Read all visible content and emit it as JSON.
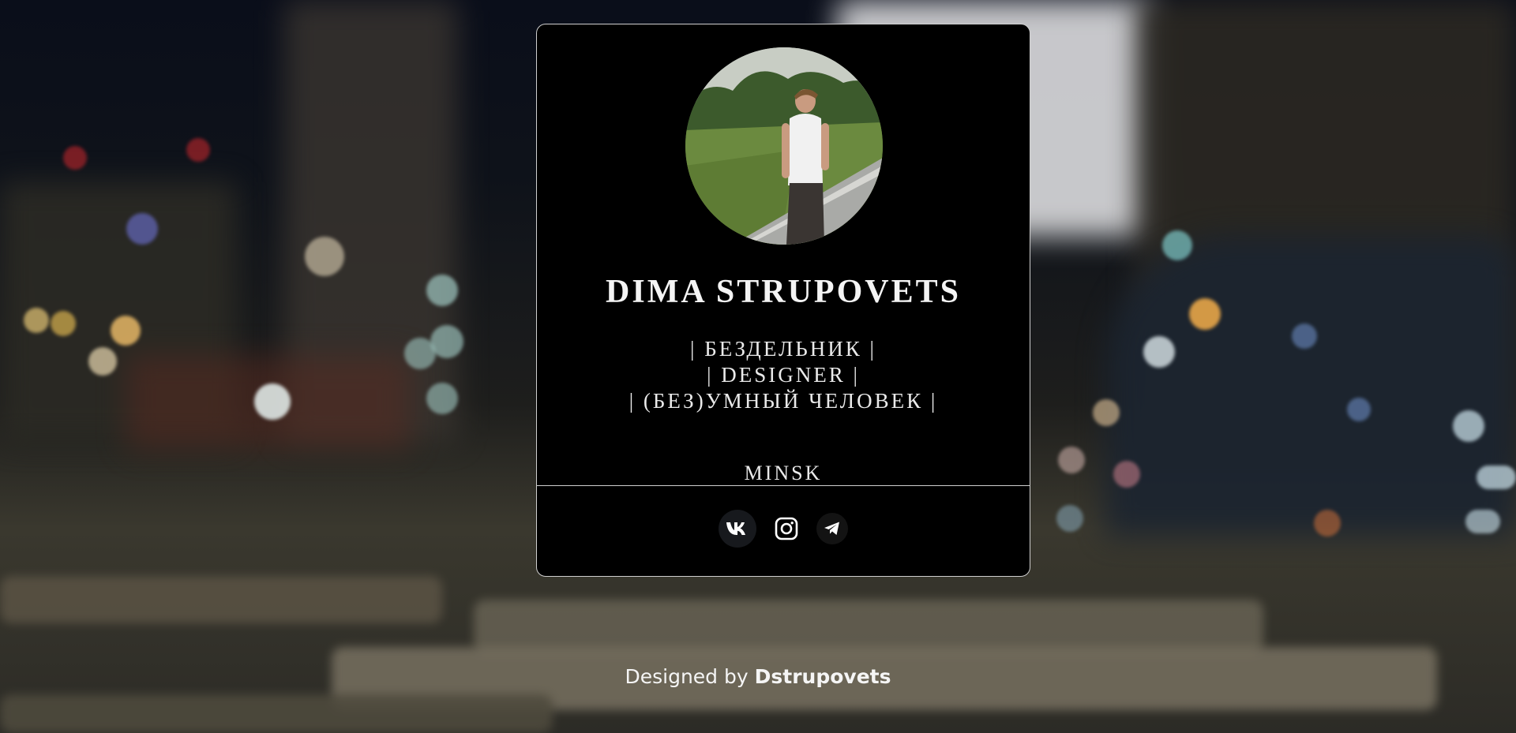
{
  "profile": {
    "name": "DIMA STRUPOVETS",
    "roles": [
      "| БЕЗДЕЛЬНИК |",
      "| DESIGNER |",
      "| (БЕЗ)УМНЫЙ ЧЕЛОВЕК |"
    ],
    "city": "MINSK"
  },
  "socials": [
    {
      "icon": "vk-icon"
    },
    {
      "icon": "instagram-icon"
    },
    {
      "icon": "telegram-icon"
    }
  ],
  "footer": {
    "prefix": "Designed by",
    "author": "Dstrupovets"
  },
  "colors": {
    "card_bg": "#000000",
    "card_border": "#cfcfcf",
    "text": "#eaeaea"
  }
}
